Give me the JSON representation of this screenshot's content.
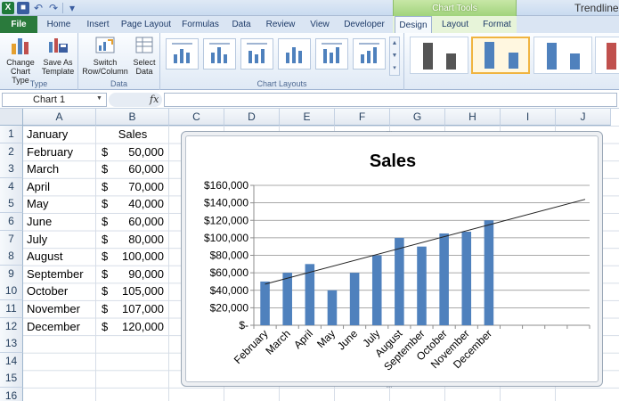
{
  "window": {
    "title": "Trendlines"
  },
  "qat": {
    "excel_glyph": "X",
    "save_glyph": "■",
    "undo_glyph": "↶",
    "redo_glyph": "↷",
    "more_glyph": "▾"
  },
  "context_tab_group": "Chart Tools",
  "tabs": [
    "File",
    "Home",
    "Insert",
    "Page Layout",
    "Formulas",
    "Data",
    "Review",
    "View",
    "Developer",
    "Design",
    "Layout",
    "Format"
  ],
  "ribbon": {
    "type_group": {
      "label": "Type",
      "change_chart_type": "Change Chart Type",
      "save_as_template": "Save As Template"
    },
    "data_group": {
      "label": "Data",
      "switch_row_column": "Switch Row/Column",
      "select_data": "Select Data"
    },
    "chart_layouts_group": {
      "label": "Chart Layouts"
    }
  },
  "formula_bar": {
    "name_box": "Chart 1",
    "fx_label": "fx",
    "value": ""
  },
  "columns": [
    "A",
    "B",
    "C",
    "D",
    "E",
    "F",
    "G",
    "H",
    "I",
    "J"
  ],
  "rows": [
    "1",
    "2",
    "3",
    "4",
    "5",
    "6",
    "7",
    "8",
    "9",
    "10",
    "11",
    "12",
    "13",
    "14",
    "15",
    "16"
  ],
  "sheet": {
    "a": [
      "January",
      "February",
      "March",
      "April",
      "May",
      "June",
      "July",
      "August",
      "September",
      "October",
      "November",
      "December"
    ],
    "b_header": "Sales",
    "currency": "$",
    "b": [
      "50,000",
      "60,000",
      "70,000",
      "40,000",
      "60,000",
      "80,000",
      "100,000",
      "90,000",
      "105,000",
      "107,000",
      "120,000"
    ]
  },
  "colors": {
    "bar": "#4f81bd",
    "file_tab": "#2a7a3c",
    "selection": "#f0b440"
  },
  "chart_data": {
    "type": "bar",
    "title": "Sales",
    "categories": [
      "February",
      "March",
      "April",
      "May",
      "June",
      "July",
      "August",
      "September",
      "October",
      "November",
      "December"
    ],
    "values": [
      50000,
      60000,
      70000,
      40000,
      60000,
      80000,
      100000,
      90000,
      105000,
      107000,
      120000
    ],
    "empty_slots": 4,
    "ylim": [
      0,
      160000
    ],
    "yticks": [
      0,
      20000,
      40000,
      60000,
      80000,
      100000,
      120000,
      140000,
      160000
    ],
    "ytick_labels": [
      "$-",
      "$20,000",
      "$40,000",
      "$60,000",
      "$80,000",
      "$100,000",
      "$120,000",
      "$140,000",
      "$160,000"
    ],
    "grid": true,
    "legend": "none",
    "trendline": {
      "type": "linear",
      "start": 47000,
      "end": 144000
    }
  }
}
